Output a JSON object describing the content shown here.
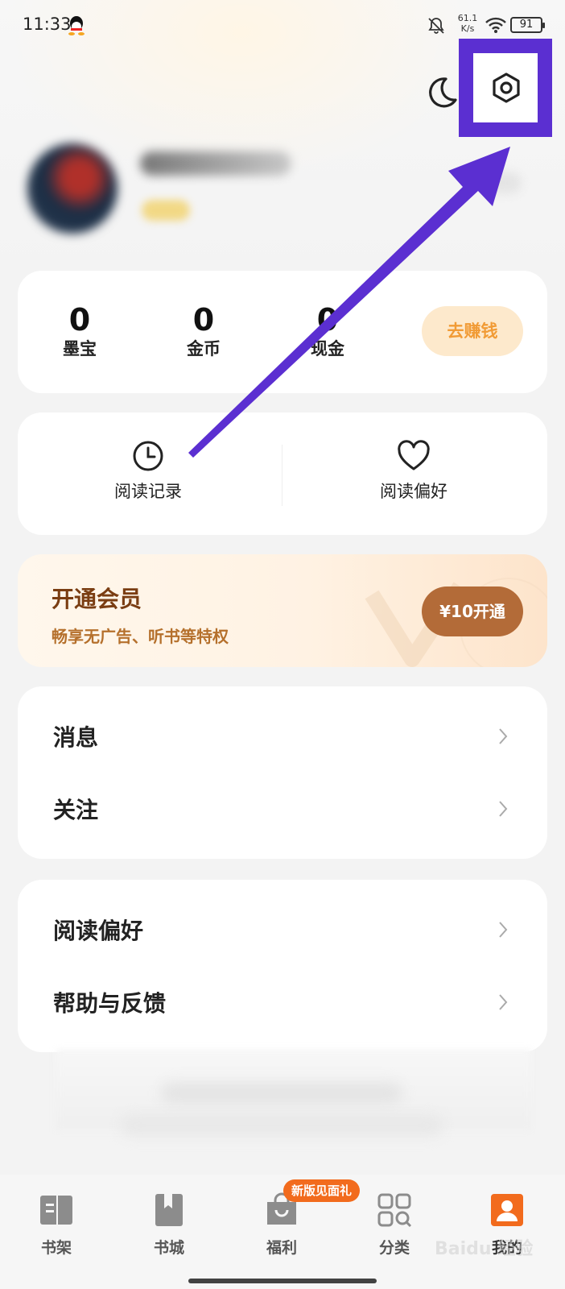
{
  "status_bar": {
    "time": "11:33",
    "net_speed_value": "61.1",
    "net_speed_unit": "K/s",
    "battery": "91"
  },
  "header": {
    "night_mode_icon": "moon-icon",
    "settings_icon": "gear-icon",
    "annotation_color": "#5b2fd1"
  },
  "wallet": {
    "items": [
      {
        "value": "0",
        "label": "墨宝"
      },
      {
        "value": "0",
        "label": "金币"
      },
      {
        "value": "0",
        "label": "现金"
      }
    ],
    "earn_button": "去赚钱"
  },
  "quick": {
    "history_label": "阅读记录",
    "preference_label": "阅读偏好"
  },
  "vip": {
    "title": "开通会员",
    "subtitle": "畅享无广告、听书等特权",
    "button": "¥10开通"
  },
  "menu1": {
    "items": [
      {
        "label": "消息"
      },
      {
        "label": "关注"
      }
    ]
  },
  "menu2": {
    "items": [
      {
        "label": "阅读偏好"
      },
      {
        "label": "帮助与反馈"
      }
    ]
  },
  "bottom_nav": {
    "badge": "新版见面礼",
    "tabs": [
      {
        "label": "书架",
        "icon": "bookshelf-icon"
      },
      {
        "label": "书城",
        "icon": "bookstore-icon"
      },
      {
        "label": "福利",
        "icon": "gift-bag-icon"
      },
      {
        "label": "分类",
        "icon": "category-icon"
      },
      {
        "label": "我的",
        "icon": "profile-icon"
      }
    ],
    "active_color": "#f26b1d"
  },
  "watermark": "Baidu 经验"
}
